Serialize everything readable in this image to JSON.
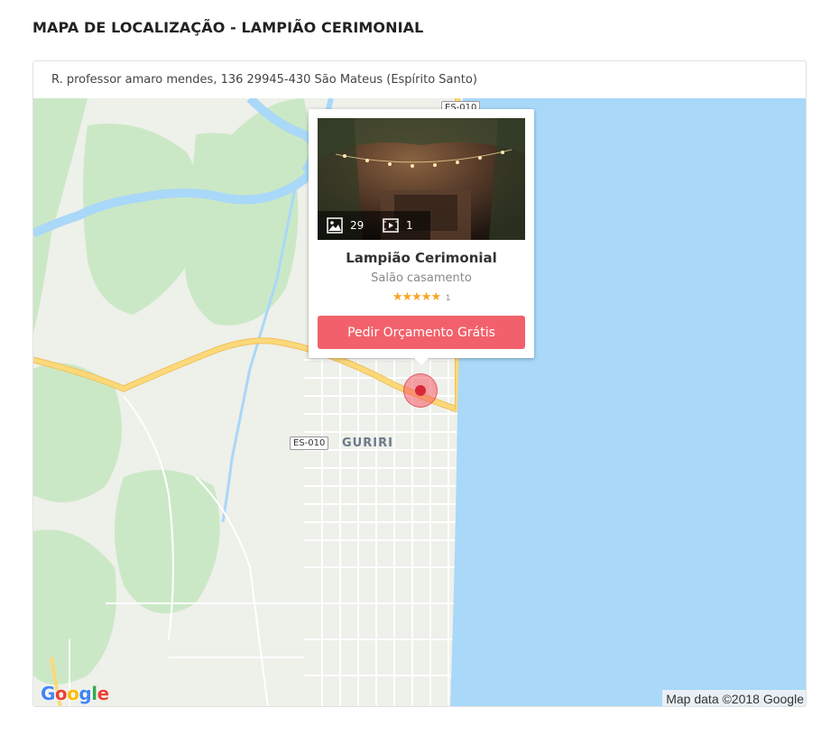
{
  "page": {
    "title": "MAPA DE LOCALIZAÇÃO - LAMPIÃO CERIMONIAL"
  },
  "map": {
    "address": "R. professor amaro mendes, 136 29945-430 São Mateus (Espírito Santo)",
    "labels": {
      "road_shield_top": "ES-010",
      "road_shield_mid": "ES-010",
      "place_name": "GURIRI"
    },
    "attribution": "Map data ©2018 Google",
    "logo": "Google",
    "colors": {
      "water": "#a9d8f8",
      "land": "#eef0ea",
      "vegetation": "#cbe8c6",
      "major_road": "#fbd97a",
      "minor_road": "#ffffff",
      "river": "#a9d8f8",
      "marker": "#d8283a"
    }
  },
  "popup": {
    "venue_name": "Lampião Cerimonial",
    "category": "Salão casamento",
    "rating_stars": "★★★★★",
    "rating_value": 5,
    "rating_count": "1",
    "photo_count": "29",
    "video_count": "1",
    "photo_icon": "image-icon",
    "video_icon": "video-icon",
    "cta_label": "Pedir Orçamento Grátis",
    "cta_color": "#f2616b"
  }
}
